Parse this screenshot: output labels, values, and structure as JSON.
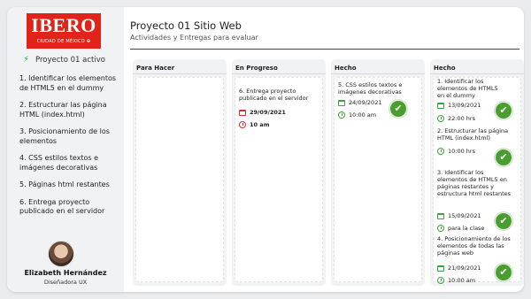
{
  "brand": {
    "logo_text": "IBERO",
    "logo_sub": "CIUDAD DE MÉXICO ✠"
  },
  "sidebar": {
    "project": "Proyecto 01 activo",
    "items": [
      {
        "label": "1. Identificar los elementos de HTML5 en el dummy"
      },
      {
        "label": "2. Estructurar las página HTML (index.html)"
      },
      {
        "label": "3. Posicionamiento de los elementos"
      },
      {
        "label": "4. CSS estilos textos e imágenes decorativas"
      },
      {
        "label": "5. Páginas html restantes"
      },
      {
        "label": "6. Entrega proyecto publicado en el servidor"
      }
    ],
    "user": {
      "name": "Elizabeth Hernández",
      "role": "Diseñadora UX"
    }
  },
  "header": {
    "title": "Proyecto 01 Sitio Web",
    "subtitle": "Actividades y Entregas para evaluar"
  },
  "columns": [
    {
      "title": "Para Hacer"
    },
    {
      "title": "En Progreso",
      "card": {
        "text": "6. Entrega proyecto publicado en el servidor",
        "date": "29/09/2021",
        "time": "10 am"
      }
    },
    {
      "title": "Hecho",
      "card": {
        "text": "5. CSS estilos textos e imágenes decorativas",
        "date": "24/09/2021",
        "time": "10:00 am"
      }
    },
    {
      "title": "Hecho",
      "cards": [
        {
          "text": "1. Identificar los elementos de HTML5 en el dummy",
          "date": "13/09/2021",
          "time": "22:00 hrs"
        },
        {
          "text": "2. Estructurar las página HTML (index.html)",
          "date": "",
          "time": "10:00 hrs"
        },
        {
          "text": "3. Identificar los elementos de HTML5 en páginas restantes y estructura html restantes",
          "date": "15/09/2021",
          "time": "para la clase"
        },
        {
          "text": "4. Posicionamiento de los elementos de todas las páginas web",
          "date": "21/09/2021",
          "time": "10:00 am"
        }
      ]
    }
  ],
  "icons": {
    "project": "bolt-icon",
    "date": "calendar-icon",
    "time": "clock-icon",
    "done": "check-circle-icon"
  },
  "colors": {
    "brand_red": "#e2231a",
    "done_green": "#4a9e2f",
    "alert_red": "#d32f2f"
  }
}
